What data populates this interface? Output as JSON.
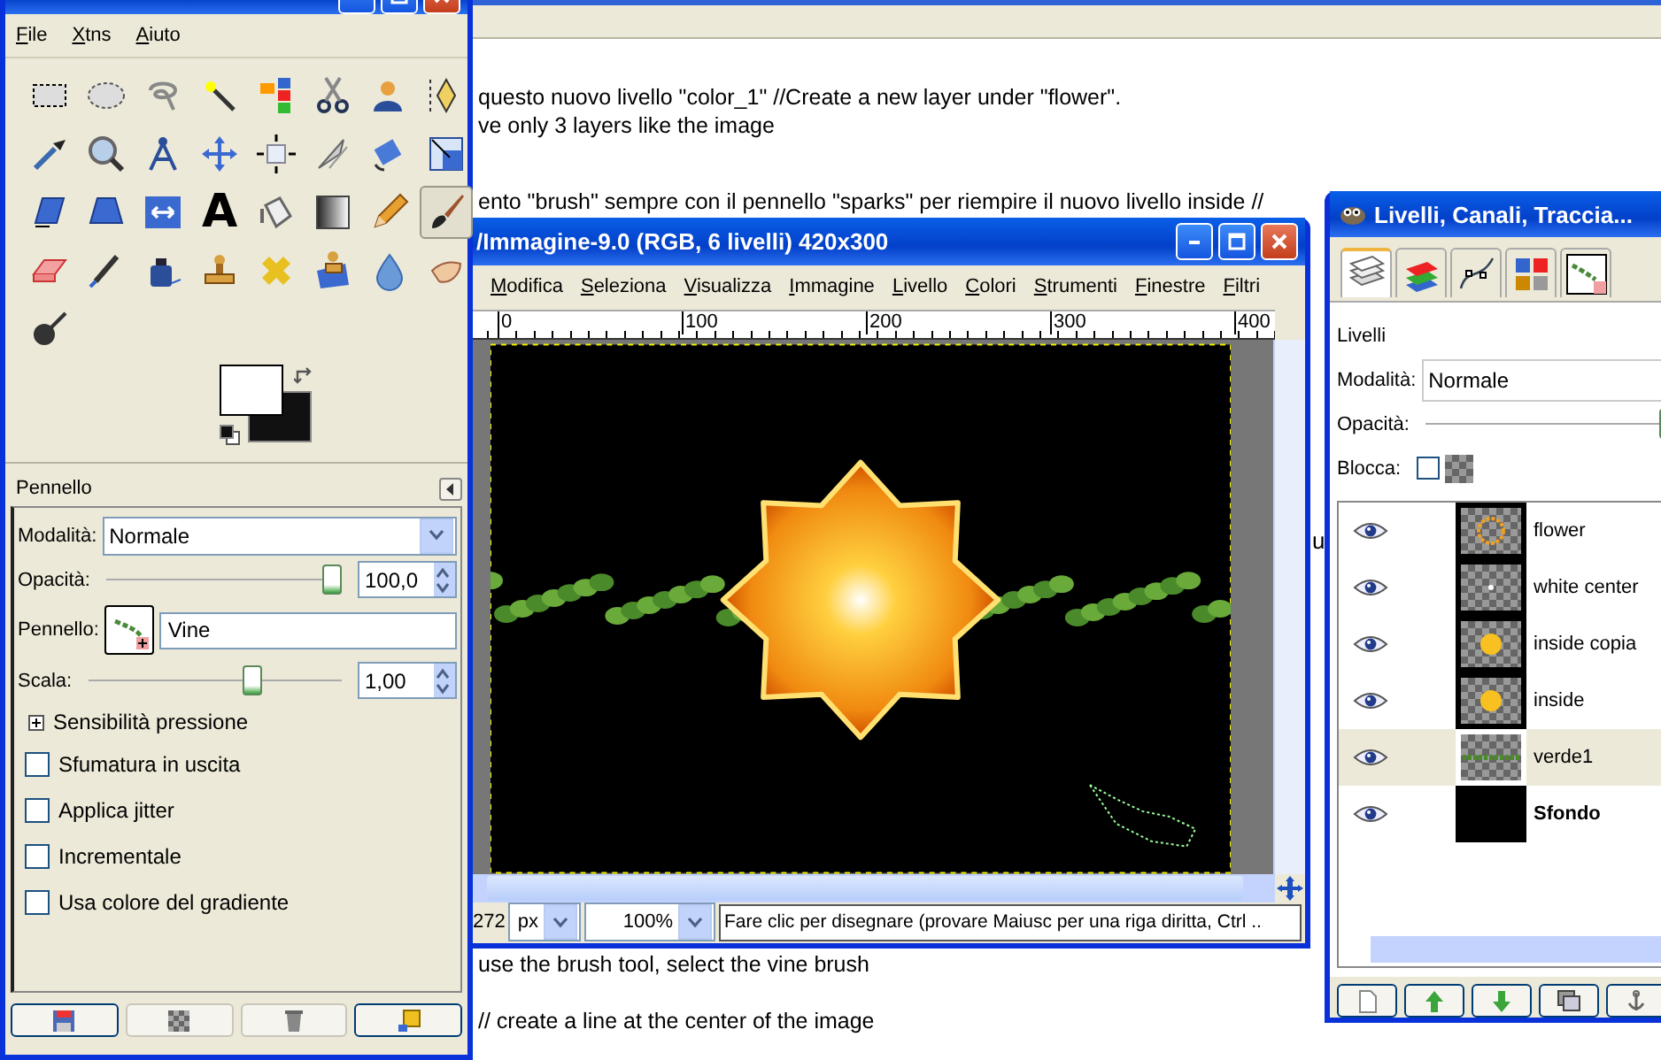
{
  "document": {
    "text_top": [
      "questo nuovo livello \"color_1\" //Create a new layer under \"flower\".",
      "ve only 3 layers like the image"
    ],
    "text_middle": "ento \"brush\" sempre con il pennello \"sparks\" per riempire il nuovo livello inside //",
    "text_side": "u",
    "text_bottom": [
      "use the brush tool, select the vine brush",
      "// create a line at the center of the image"
    ]
  },
  "toolbox": {
    "menu": [
      "File",
      "Xtns",
      "Aiuto"
    ],
    "tools": [
      {
        "kind": "rect-select",
        "selected": false
      },
      {
        "kind": "ellipse-select",
        "selected": false
      },
      {
        "kind": "lasso",
        "selected": false
      },
      {
        "kind": "wand",
        "selected": false
      },
      {
        "kind": "color-select",
        "selected": false
      },
      {
        "kind": "scissors",
        "selected": false
      },
      {
        "kind": "foreground-select",
        "selected": false
      },
      {
        "kind": "paths",
        "selected": false
      },
      {
        "kind": "picker",
        "selected": false
      },
      {
        "kind": "magnifier",
        "selected": false
      },
      {
        "kind": "measure",
        "selected": false
      },
      {
        "kind": "move",
        "selected": false
      },
      {
        "kind": "align",
        "selected": false
      },
      {
        "kind": "knife",
        "selected": false
      },
      {
        "kind": "rotate",
        "selected": false
      },
      {
        "kind": "scale",
        "selected": false
      },
      {
        "kind": "shear",
        "selected": false
      },
      {
        "kind": "perspective",
        "selected": false
      },
      {
        "kind": "flip",
        "selected": false
      },
      {
        "kind": "text",
        "glyph": "A",
        "selected": false
      },
      {
        "kind": "bucket",
        "selected": false
      },
      {
        "kind": "gradient",
        "selected": false
      },
      {
        "kind": "pencil",
        "selected": false
      },
      {
        "kind": "brush",
        "selected": true
      },
      {
        "kind": "eraser",
        "selected": false
      },
      {
        "kind": "airbrush",
        "selected": false
      },
      {
        "kind": "ink",
        "selected": false
      },
      {
        "kind": "clone",
        "selected": false
      },
      {
        "kind": "heal",
        "selected": false
      },
      {
        "kind": "perspective-clone",
        "selected": false
      },
      {
        "kind": "blur",
        "selected": false
      },
      {
        "kind": "smudge",
        "selected": false
      },
      {
        "kind": "dodge",
        "selected": false
      }
    ],
    "tool_options": {
      "title": "Pennello",
      "mode_label": "Modalità:",
      "mode": "Normale",
      "opacity_label": "Opacità:",
      "opacity": {
        "level": 1.0,
        "value": "100,0"
      },
      "brush_label": "Pennello:",
      "brush": "Vine",
      "scale_label": "Scala:",
      "scale": {
        "level": 0.66,
        "value": "1,00"
      },
      "pressure": {
        "label": "Sensibilità pressione",
        "expanded": false
      },
      "options": [
        {
          "label": "Sfumatura in uscita",
          "checked": false
        },
        {
          "label": "Applica jitter",
          "checked": false
        },
        {
          "label": "Incrementale",
          "checked": false
        },
        {
          "label": "Usa colore del gradiente",
          "checked": false
        }
      ]
    }
  },
  "image_window": {
    "title": "/Immagine-9.0 (RGB, 6 livelli) 420x300",
    "menu": [
      "Modifica",
      "Seleziona",
      "Visualizza",
      "Immagine",
      "Livello",
      "Colori",
      "Strumenti",
      "Finestre",
      "Filtri"
    ],
    "ruler_labels": [
      "0",
      "100",
      "200",
      "300",
      "400"
    ],
    "status": {
      "coordinate": "272",
      "unit": "px",
      "zoom": "100%",
      "message": "Fare clic per disegnare (provare Maiusc per una riga diritta, Ctrl .."
    }
  },
  "layers_window": {
    "title": "Livelli, Canali, Traccia...",
    "tabs": [
      {
        "kind": "layers",
        "selected": true
      },
      {
        "kind": "channels",
        "selected": false
      },
      {
        "kind": "paths",
        "selected": false
      },
      {
        "kind": "colormap",
        "selected": false
      },
      {
        "kind": "brush",
        "selected": false
      }
    ],
    "heading": "Livelli",
    "mode_label": "Modalità:",
    "mode": "Normale",
    "opacity_label": "Opacità:",
    "opacity": {
      "level": 1.0
    },
    "lock_label": "Blocca:",
    "lock": {
      "checked": false
    },
    "layers": [
      {
        "name": "flower",
        "visible": true,
        "selected": false,
        "kind": "ring",
        "bold": false
      },
      {
        "name": "white center",
        "visible": true,
        "selected": false,
        "kind": "dot",
        "bold": false
      },
      {
        "name": "inside copia",
        "visible": true,
        "selected": false,
        "kind": "blob",
        "bold": false
      },
      {
        "name": "inside",
        "visible": true,
        "selected": false,
        "kind": "blob",
        "bold": false
      },
      {
        "name": "verde1",
        "visible": true,
        "selected": true,
        "kind": "band",
        "bold": false
      },
      {
        "name": "Sfondo",
        "visible": true,
        "selected": false,
        "kind": "black",
        "bold": true
      }
    ]
  }
}
